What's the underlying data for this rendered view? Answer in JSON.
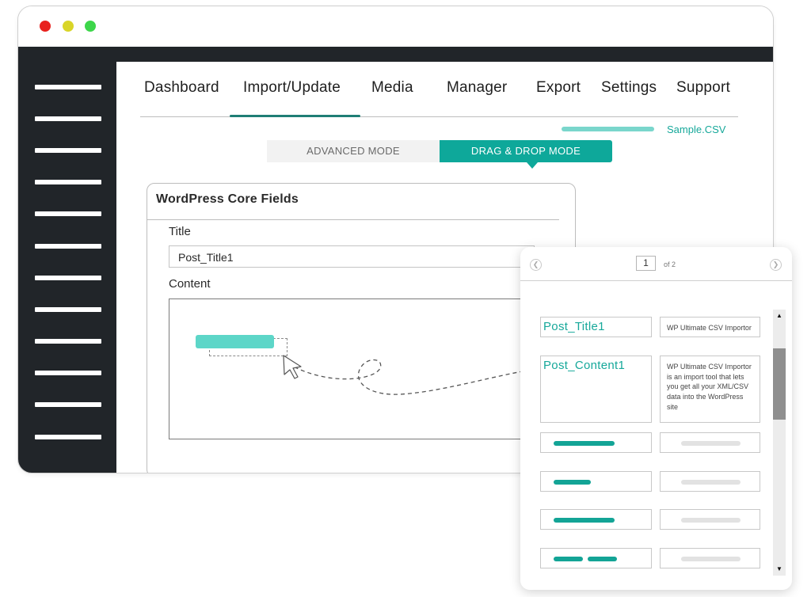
{
  "nav": {
    "items": [
      {
        "label": "Dashboard"
      },
      {
        "label": "Import/Update"
      },
      {
        "label": "Media"
      },
      {
        "label": "Manager"
      },
      {
        "label": "Export"
      },
      {
        "label": "Settings"
      },
      {
        "label": "Support"
      }
    ],
    "active": "Import/Update"
  },
  "file": {
    "name": "Sample.CSV"
  },
  "modes": {
    "advanced": "ADVANCED MODE",
    "drag_drop": "DRAG & DROP MODE",
    "active": "DRAG & DROP MODE"
  },
  "core_fields": {
    "title": "WordPress Core Fields",
    "title_label": "Title",
    "title_value": "Post_Title1",
    "content_label": "Content"
  },
  "mapping": {
    "page": "1",
    "of_label": "of 2",
    "rows": [
      {
        "key": "Post_Title1",
        "value": "WP Ultimate CSV Importor"
      },
      {
        "key": "Post_Content1",
        "value": "WP Ultimate CSV Importor is an import tool that lets you get all your XML/CSV data into the WordPress site"
      }
    ]
  },
  "icons": {
    "prev": "chevron-left-icon",
    "next": "chevron-right-icon",
    "cursor": "cursor-arrow-icon",
    "scroll_up": "triangle-up-icon",
    "scroll_down": "triangle-down-icon"
  },
  "colors": {
    "accent": "#0ea89a",
    "accent_light": "#5dd6c8",
    "sidebar": "#212529",
    "dot_red": "#e8211d",
    "dot_yellow": "#d9d528",
    "dot_green": "#3dd64a"
  }
}
